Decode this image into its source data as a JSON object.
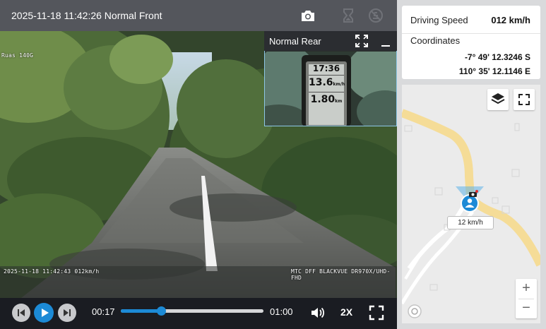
{
  "video": {
    "title": "2025-11-18 11:42:26 Normal Front",
    "rear_title": "Normal Rear",
    "osd_sign": "Ruas 140G",
    "osd_timestamp": "2025-11-18 11:42:43 012km/h",
    "osd_device": "MTC DFF BLACKVUE DR970X/UHD-FHD",
    "rear_gauge": {
      "time": "17:36",
      "speed": "13.6",
      "speed_unit": "km/h",
      "distance": "1.80",
      "distance_unit": "km"
    }
  },
  "controls": {
    "current_time": "00:17",
    "total_time": "01:00",
    "progress_fraction": 0.283,
    "speed": "2X"
  },
  "info": {
    "speed_label": "Driving Speed",
    "speed_value": "012 km/h",
    "coords_label": "Coordinates",
    "latitude": "-7° 49' 12.3246 S",
    "longitude": "110° 35' 12.1146 E"
  },
  "map": {
    "speed_label": "12 km/h",
    "zoom_in": "+",
    "zoom_out": "−"
  },
  "colors": {
    "accent": "#1c8ad6",
    "road": "#f5dc97",
    "vehicle_marker": "#1c8ad6",
    "rear_border": "#8dc7e6"
  },
  "icons": {
    "header": [
      "camera-icon",
      "hourglass-icon",
      "no-signal-icon"
    ],
    "rear": [
      "expand-icon",
      "minimize-icon"
    ],
    "controls": [
      "prev-icon",
      "play-icon",
      "next-icon",
      "volume-icon",
      "fullscreen-icon"
    ],
    "map": [
      "layers-icon",
      "fullscreen-icon",
      "locate-icon",
      "car-icon",
      "user-icon"
    ]
  }
}
